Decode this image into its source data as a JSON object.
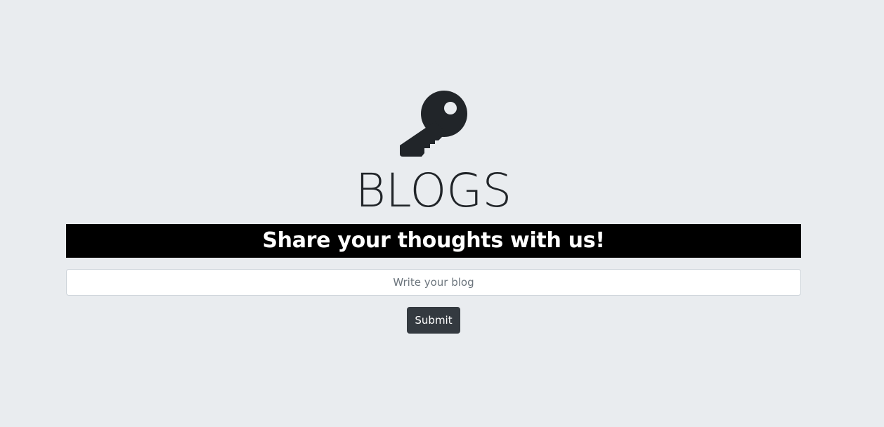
{
  "header": {
    "icon": "key-icon",
    "title": "BLOGS"
  },
  "banner": {
    "text": "Share your thoughts with us!"
  },
  "blog_form": {
    "input_value": "",
    "input_placeholder": "Write your blog",
    "submit_label": "Submit"
  },
  "colors": {
    "background": "#e9ecef",
    "icon": "#212529",
    "banner_background": "#000000",
    "banner_text": "#ffffff",
    "button_background": "#343a40"
  }
}
